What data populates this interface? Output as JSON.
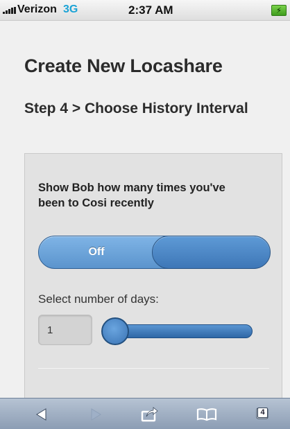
{
  "status_bar": {
    "carrier": "Verizon",
    "network": "3G",
    "time": "2:37 AM",
    "battery_icon": "battery-charging-icon",
    "signal_icon": "signal-bars-icon"
  },
  "page": {
    "title": "Create New Locashare",
    "step_title": "Step 4 > Choose History Interval"
  },
  "form": {
    "question": "Show Bob how many times you've been to Cosi recently",
    "toggle": {
      "label": "Off",
      "state": "off"
    },
    "slider_label": "Select number of days:",
    "days_value": "1",
    "slider_level": 0
  },
  "toolbar": {
    "back_icon": "back-arrow-icon",
    "forward_icon": "forward-arrow-icon",
    "share_icon": "share-icon",
    "bookmarks_icon": "bookmarks-icon",
    "tabs_icon": "tabs-icon",
    "tab_count": "4"
  },
  "colors": {
    "accent": "#4a85c4",
    "network": "#1aa3d6",
    "toolbar": "#a0afc3",
    "battery": "#5cb832"
  }
}
